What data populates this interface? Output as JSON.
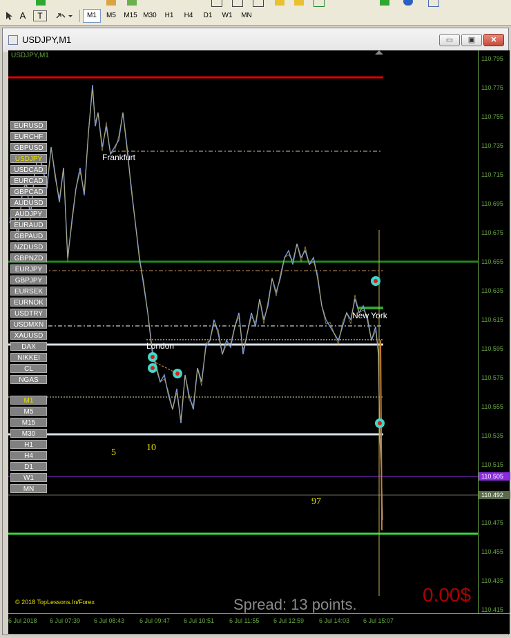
{
  "toolbar": {
    "timeframes": [
      "M1",
      "M5",
      "M15",
      "M30",
      "H1",
      "H4",
      "D1",
      "W1",
      "MN"
    ],
    "active_timeframe": "M1",
    "text_tool": "A",
    "text_label_tool": "T"
  },
  "window": {
    "title": "USDJPY,M1",
    "minimize": "▭",
    "restore": "▣",
    "close": "✕"
  },
  "chart": {
    "title": "USDJPY,M1",
    "price_ticks": [
      "110.795",
      "110.775",
      "110.755",
      "110.735",
      "110.715",
      "110.695",
      "110.675",
      "110.655",
      "110.635",
      "110.615",
      "110.595",
      "110.575",
      "110.555",
      "110.535",
      "110.515",
      "110.495",
      "110.475",
      "110.455",
      "110.435",
      "110.415"
    ],
    "bid_tag": "110.505",
    "ask_tag": "110.492",
    "time_ticks": [
      "6 Jul 2018",
      "6 Jul 07:39",
      "6 Jul 08:43",
      "6 Jul 09:47",
      "6 Jul 10:51",
      "6 Jul 11:55",
      "6 Jul 12:59",
      "6 Jul 14:03",
      "6 Jul 15:07"
    ],
    "session_labels": {
      "frankfurt": "Frankfurt",
      "london": "London",
      "newyork": "New York"
    },
    "numbers": {
      "n5": "5",
      "n10": "10",
      "n97": "97"
    },
    "copyright": "© 2018 TopLessons.In/Forex",
    "spread": "Spread: 13 points.",
    "profit": "0.00$",
    "colors": {
      "red_line": "#e00000",
      "green_line": "#1e8a1e",
      "lime_line": "#33dd33",
      "bid": "#8a2be2",
      "candles": "#c8b450",
      "wick": "#7a9ad8"
    }
  },
  "symbols": [
    "EURUSD",
    "EURCHF",
    "GBPUSD",
    "USDJPY",
    "USDCAD",
    "EURCAD",
    "GBPCAD",
    "AUDUSD",
    "AUDJPY",
    "EURAUD",
    "GBPAUD",
    "NZDUSD",
    "GBPNZD",
    "EURJPY",
    "GBPJPY",
    "EURSEK",
    "EURNOK",
    "USDTRY",
    "USDMXN",
    "XAUUSD",
    "DAX",
    "NIKKEI",
    "CL",
    "NGAS"
  ],
  "selected_symbol": "USDJPY",
  "chart_timeframes": [
    "M1",
    "M5",
    "M15",
    "M30",
    "H1",
    "H4",
    "D1",
    "W1",
    "MN"
  ],
  "chart_active_tf": "M1"
}
